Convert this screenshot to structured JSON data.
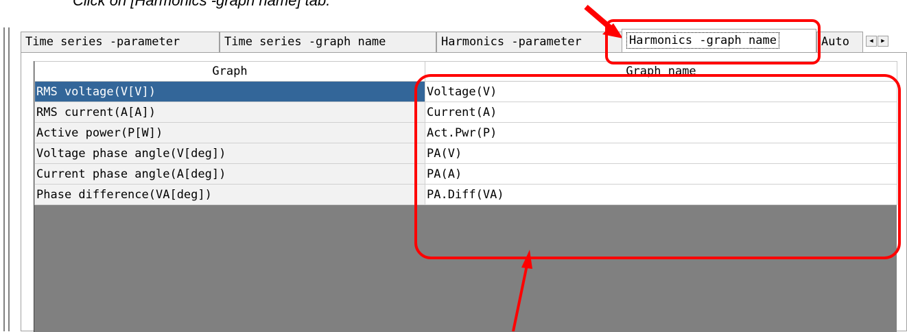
{
  "instruction": {
    "text": "Click on [Harmonics -graph name] tab."
  },
  "tabs": [
    {
      "label": "Time series -parameter",
      "active": false
    },
    {
      "label": "Time series -graph name",
      "active": false
    },
    {
      "label": "Harmonics -parameter",
      "active": false
    },
    {
      "label": "Harmonics -graph name",
      "active": true
    },
    {
      "label": "Auto",
      "active": false
    }
  ],
  "tab_scroll": {
    "left": "◀",
    "right": "▶"
  },
  "table": {
    "headers": {
      "graph": "Graph",
      "graph_name": "Graph name"
    },
    "rows": [
      {
        "graph": "RMS voltage(V[V])",
        "graph_name": "Voltage(V)",
        "selected": true
      },
      {
        "graph": "RMS current(A[A])",
        "graph_name": "Current(A)",
        "selected": false
      },
      {
        "graph": "Active power(P[W])",
        "graph_name": "Act.Pwr(P)",
        "selected": false
      },
      {
        "graph": "Voltage phase angle(V[deg])",
        "graph_name": "PA(V)",
        "selected": false
      },
      {
        "graph": "Current phase angle(A[deg])",
        "graph_name": "PA(A)",
        "selected": false
      },
      {
        "graph": "Phase difference(VA[deg])",
        "graph_name": "PA.Diff(VA)",
        "selected": false
      }
    ]
  },
  "colors": {
    "selected_row": "#336699",
    "annotation": "#ff0000",
    "grid_empty_area": "#808080"
  }
}
